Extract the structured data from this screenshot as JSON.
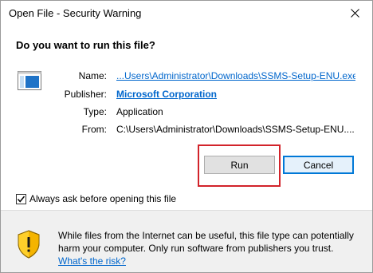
{
  "window": {
    "title": "Open File - Security Warning"
  },
  "dialog": {
    "question": "Do you want to run this file?",
    "fields": [
      {
        "label": "Name:",
        "value": "...Users\\Administrator\\Downloads\\SSMS-Setup-ENU.exe"
      },
      {
        "label": "Publisher:",
        "value": "Microsoft Corporation"
      },
      {
        "label": "Type:",
        "value": "Application"
      },
      {
        "label": "From:",
        "value": "C:\\Users\\Administrator\\Downloads\\SSMS-Setup-ENU...."
      }
    ],
    "run_label": "Run",
    "cancel_label": "Cancel",
    "always_ask_label": "Always ask before opening this file",
    "always_ask_checked": true
  },
  "warning": {
    "line1": "While files from the Internet can be useful, this file type can potentially",
    "line2": "harm your computer. Only run software from publishers you trust.",
    "risk_link": "What's the risk?"
  },
  "colors": {
    "link": "#0066cc",
    "highlight": "#d2232a",
    "default_button_border": "#0078d7"
  }
}
